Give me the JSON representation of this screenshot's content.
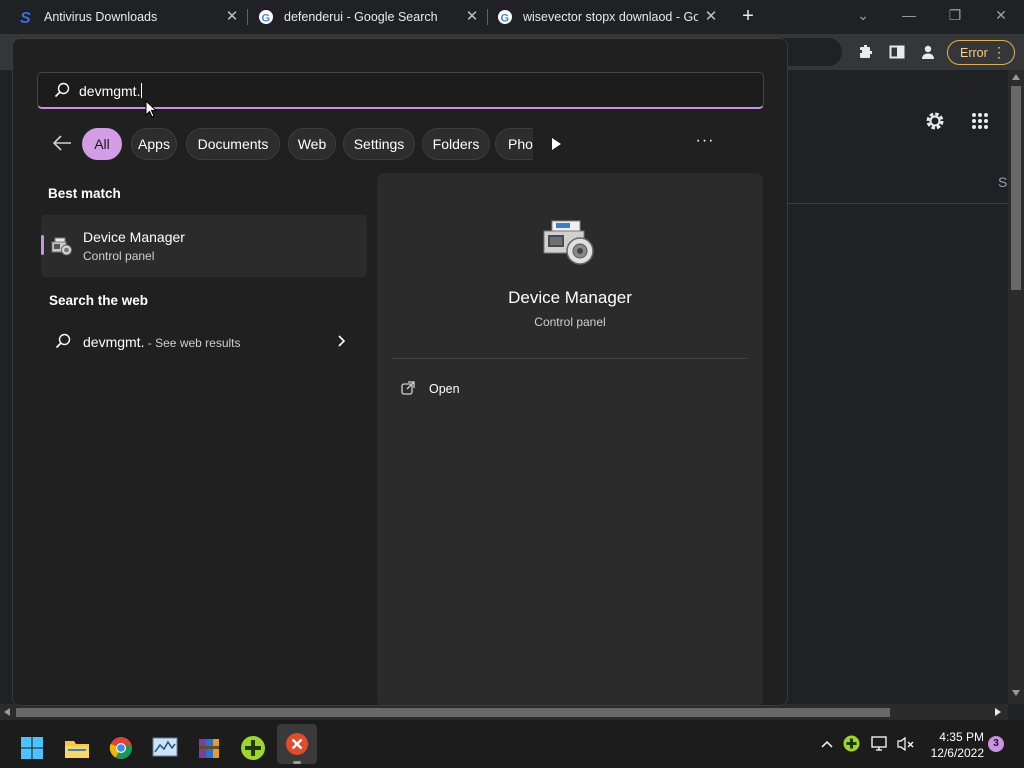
{
  "browser": {
    "tabs": [
      {
        "title": "Antivirus Downloads",
        "favicon": "s-logo-icon"
      },
      {
        "title": "defenderui - Google Search",
        "favicon": "google-icon"
      },
      {
        "title": "wisevector stopx downlaod - Goo",
        "favicon": "google-icon"
      }
    ],
    "error_button_label": "Error",
    "page_partial_text": "S"
  },
  "search": {
    "query": "devmgmt.",
    "filters": [
      "All",
      "Apps",
      "Documents",
      "Web",
      "Settings",
      "Folders",
      "Pho"
    ],
    "active_filter": "All",
    "best_match_heading": "Best match",
    "best_match": {
      "title": "Device Manager",
      "subtitle": "Control panel"
    },
    "web_heading": "Search the web",
    "web_result": {
      "query": "devmgmt.",
      "suffix": " - See web results"
    },
    "preview": {
      "title": "Device Manager",
      "subtitle": "Control panel",
      "action": "Open"
    }
  },
  "taskbar": {
    "apps": [
      "windows-start-icon",
      "file-explorer-icon",
      "chrome-icon",
      "resource-monitor-icon",
      "winrar-icon",
      "green-app-icon",
      "red-x-app-icon"
    ],
    "time": "4:35 PM",
    "date": "12/6/2022",
    "notification_count": "3"
  },
  "colors": {
    "accent": "#d39de6",
    "warning": "#e3b341",
    "panel": "#202020"
  }
}
